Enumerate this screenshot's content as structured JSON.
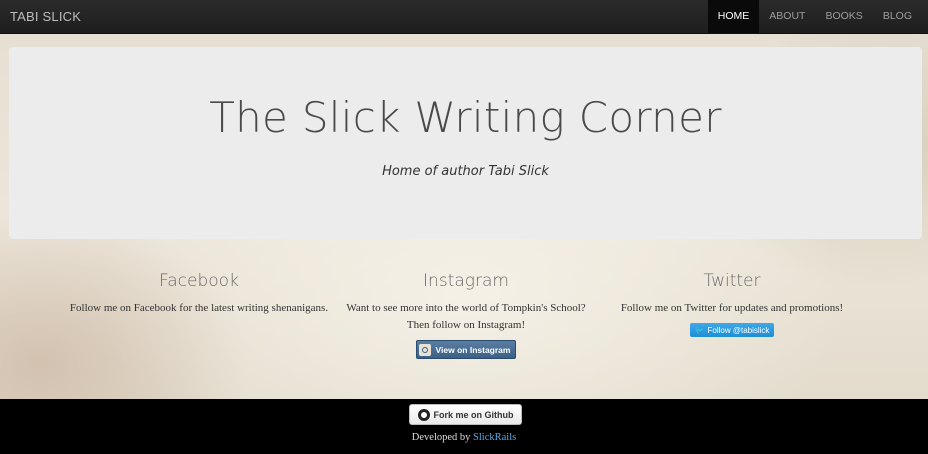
{
  "navbar": {
    "brand": "TABI SLICK",
    "items": [
      {
        "label": "HOME",
        "active": true
      },
      {
        "label": "ABOUT",
        "active": false
      },
      {
        "label": "BOOKS",
        "active": false
      },
      {
        "label": "BLOG",
        "active": false
      }
    ]
  },
  "jumbotron": {
    "title": "The Slick Writing Corner",
    "subtitle": "Home of author Tabi Slick"
  },
  "columns": [
    {
      "heading": "Facebook",
      "text": "Follow me on Facebook for the latest writing shenanigans."
    },
    {
      "heading": "Instagram",
      "text": "Want to see more into the world of Tompkin's School? Then follow on Instagram!",
      "button": "View on Instagram"
    },
    {
      "heading": "Twitter",
      "text": "Follow me on Twitter for updates and promotions!",
      "button": "Follow @tabislick"
    }
  ],
  "footer": {
    "github_button": "Fork me on Github",
    "developed_by": "Developed by",
    "developer": "SlickRails"
  },
  "colors": {
    "navbar": "#222222",
    "active_tab": "#0a0a0a",
    "jumbotron": "#ececec",
    "instagram_button": "#3b5f86",
    "twitter_button": "#1d8fd6",
    "footer": "#000000",
    "link": "#5aa7e6"
  },
  "icons": [
    "github-icon",
    "instagram-icon",
    "twitter-bird-icon"
  ]
}
